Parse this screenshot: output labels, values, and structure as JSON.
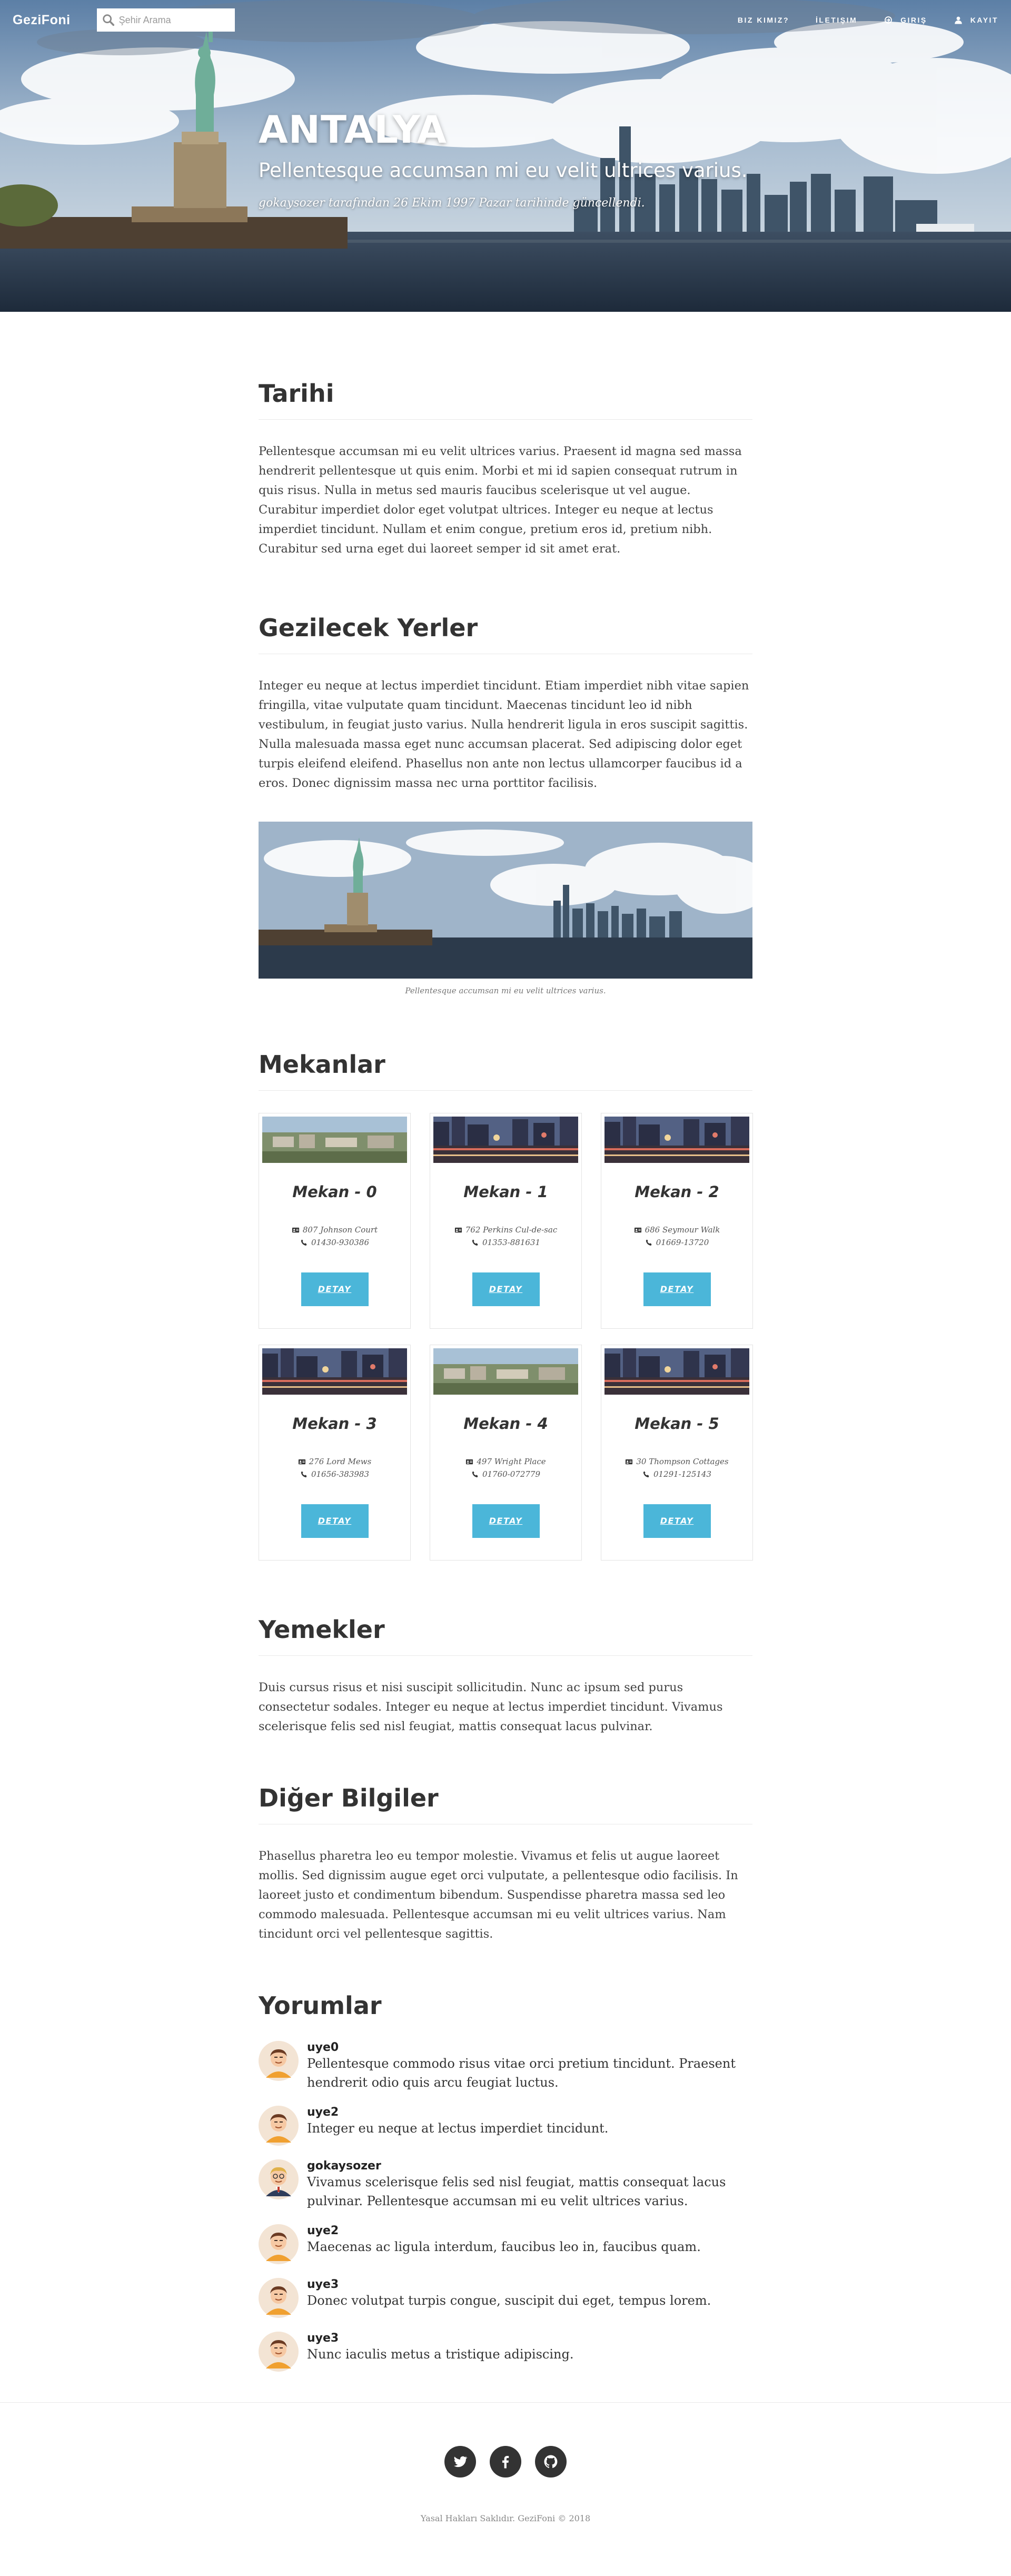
{
  "nav": {
    "brand": "GeziFoni",
    "search_placeholder": "Şehir Arama",
    "links": [
      {
        "label": "Biz Kimiz?",
        "icon": ""
      },
      {
        "label": "İletişim",
        "icon": ""
      },
      {
        "label": "Giriş",
        "icon": "sign-in-icon"
      },
      {
        "label": "Kayıt",
        "icon": "user-icon"
      }
    ]
  },
  "hero": {
    "title": "ANTALYA",
    "subtitle": "Pellentesque accumsan mi eu velit ultrices varius.",
    "meta": "gokaysozer tarafından 26 Ekim 1997 Pazar tarihinde güncellendi."
  },
  "sections": {
    "tarihi": {
      "title": "Tarihi",
      "text": "Pellentesque accumsan mi eu velit ultrices varius. Praesent id magna sed massa hendrerit pellentesque ut quis enim. Morbi et mi id sapien consequat rutrum in quis risus. Nulla in metus sed mauris faucibus scelerisque ut vel augue. Curabitur imperdiet dolor eget volutpat ultrices. Integer eu neque at lectus imperdiet tincidunt. Nullam et enim congue, pretium eros id, pretium nibh. Curabitur sed urna eget dui laoreet semper id sit amet erat."
    },
    "gezilecek": {
      "title": "Gezilecek Yerler",
      "text": "Integer eu neque at lectus imperdiet tincidunt. Etiam imperdiet nibh vitae sapien fringilla, vitae vulputate quam tincidunt. Maecenas tincidunt leo id nibh vestibulum, in feugiat justo varius. Nulla hendrerit ligula in eros suscipit sagittis. Nulla malesuada massa eget nunc accumsan placerat. Sed adipiscing dolor eget turpis eleifend eleifend. Phasellus non ante non lectus ullamcorper faucibus id a eros. Donec dignissim massa nec urna porttitor facilisis.",
      "caption": "Pellentesque accumsan mi eu velit ultrices varius."
    },
    "mekanlar": {
      "title": "Mekanlar",
      "button_label": "DETAY",
      "items": [
        {
          "name": "Mekan - 0",
          "address": "807 Johnson Court",
          "phone": "01430-930386",
          "thumb": "aerial"
        },
        {
          "name": "Mekan - 1",
          "address": "762 Perkins Cul-de-sac",
          "phone": "01353-881631",
          "thumb": "night"
        },
        {
          "name": "Mekan - 2",
          "address": "686 Seymour Walk",
          "phone": "01669-13720",
          "thumb": "night"
        },
        {
          "name": "Mekan - 3",
          "address": "276 Lord Mews",
          "phone": "01656-383983",
          "thumb": "night"
        },
        {
          "name": "Mekan - 4",
          "address": "497 Wright Place",
          "phone": "01760-072779",
          "thumb": "aerial"
        },
        {
          "name": "Mekan - 5",
          "address": "30 Thompson Cottages",
          "phone": "01291-125143",
          "thumb": "night"
        }
      ]
    },
    "yemekler": {
      "title": "Yemekler",
      "text": "Duis cursus risus et nisi suscipit sollicitudin. Nunc ac ipsum sed purus consectetur sodales. Integer eu neque at lectus imperdiet tincidunt. Vivamus scelerisque felis sed nisl feugiat, mattis consequat lacus pulvinar."
    },
    "diger": {
      "title": "Diğer Bilgiler",
      "text": "Phasellus pharetra leo eu tempor molestie. Vivamus et felis ut augue laoreet mollis. Sed dignissim augue eget orci vulputate, a pellentesque odio facilisis. In laoreet justo et condimentum bibendum. Suspendisse pharetra massa sed leo commodo malesuada. Pellentesque accumsan mi eu velit ultrices varius. Nam tincidunt orci vel pellentesque sagittis."
    },
    "yorumlar": {
      "title": "Yorumlar",
      "comments": [
        {
          "user": "uye0",
          "text": "Pellentesque commodo risus vitae orci pretium tincidunt. Praesent hendrerit odio quis arcu feugiat luctus.",
          "avatar": "man-orange"
        },
        {
          "user": "uye2",
          "text": "Integer eu neque at lectus imperdiet tincidunt.",
          "avatar": "man-orange"
        },
        {
          "user": "gokaysozer",
          "text": "Vivamus scelerisque felis sed nisl feugiat, mattis consequat lacus pulvinar. Pellentesque accumsan mi eu velit ultrices varius.",
          "avatar": "man-suit"
        },
        {
          "user": "uye2",
          "text": "Maecenas ac ligula interdum, faucibus leo in, faucibus quam.",
          "avatar": "man-orange"
        },
        {
          "user": "uye3",
          "text": "Donec volutpat turpis congue, suscipit dui eget, tempus lorem.",
          "avatar": "man-orange"
        },
        {
          "user": "uye3",
          "text": "Nunc iaculis metus a tristique adipiscing.",
          "avatar": "man-orange"
        }
      ]
    }
  },
  "footer": {
    "socials": [
      "twitter-icon",
      "facebook-icon",
      "github-icon"
    ],
    "copyright": "Yasal Hakları Saklıdır. GeziFoni © 2018"
  },
  "colors": {
    "accent": "#4bb6d9",
    "text": "#333333",
    "social_bg": "#333333"
  }
}
